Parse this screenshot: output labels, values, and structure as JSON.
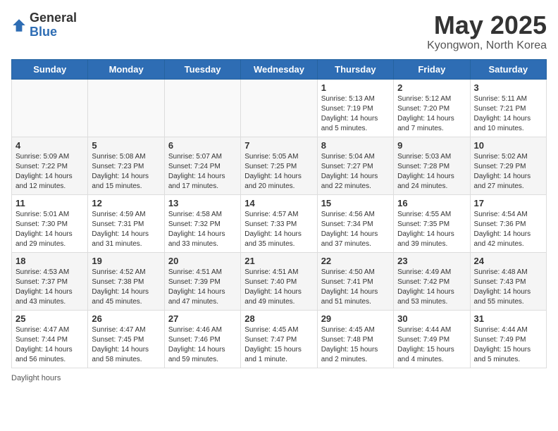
{
  "logo": {
    "general": "General",
    "blue": "Blue"
  },
  "title": "May 2025",
  "subtitle": "Kyongwon, North Korea",
  "days_of_week": [
    "Sunday",
    "Monday",
    "Tuesday",
    "Wednesday",
    "Thursday",
    "Friday",
    "Saturday"
  ],
  "weeks": [
    [
      {
        "day": "",
        "info": ""
      },
      {
        "day": "",
        "info": ""
      },
      {
        "day": "",
        "info": ""
      },
      {
        "day": "",
        "info": ""
      },
      {
        "day": "1",
        "info": "Sunrise: 5:13 AM\nSunset: 7:19 PM\nDaylight: 14 hours and 5 minutes."
      },
      {
        "day": "2",
        "info": "Sunrise: 5:12 AM\nSunset: 7:20 PM\nDaylight: 14 hours and 7 minutes."
      },
      {
        "day": "3",
        "info": "Sunrise: 5:11 AM\nSunset: 7:21 PM\nDaylight: 14 hours and 10 minutes."
      }
    ],
    [
      {
        "day": "4",
        "info": "Sunrise: 5:09 AM\nSunset: 7:22 PM\nDaylight: 14 hours and 12 minutes."
      },
      {
        "day": "5",
        "info": "Sunrise: 5:08 AM\nSunset: 7:23 PM\nDaylight: 14 hours and 15 minutes."
      },
      {
        "day": "6",
        "info": "Sunrise: 5:07 AM\nSunset: 7:24 PM\nDaylight: 14 hours and 17 minutes."
      },
      {
        "day": "7",
        "info": "Sunrise: 5:05 AM\nSunset: 7:25 PM\nDaylight: 14 hours and 20 minutes."
      },
      {
        "day": "8",
        "info": "Sunrise: 5:04 AM\nSunset: 7:27 PM\nDaylight: 14 hours and 22 minutes."
      },
      {
        "day": "9",
        "info": "Sunrise: 5:03 AM\nSunset: 7:28 PM\nDaylight: 14 hours and 24 minutes."
      },
      {
        "day": "10",
        "info": "Sunrise: 5:02 AM\nSunset: 7:29 PM\nDaylight: 14 hours and 27 minutes."
      }
    ],
    [
      {
        "day": "11",
        "info": "Sunrise: 5:01 AM\nSunset: 7:30 PM\nDaylight: 14 hours and 29 minutes."
      },
      {
        "day": "12",
        "info": "Sunrise: 4:59 AM\nSunset: 7:31 PM\nDaylight: 14 hours and 31 minutes."
      },
      {
        "day": "13",
        "info": "Sunrise: 4:58 AM\nSunset: 7:32 PM\nDaylight: 14 hours and 33 minutes."
      },
      {
        "day": "14",
        "info": "Sunrise: 4:57 AM\nSunset: 7:33 PM\nDaylight: 14 hours and 35 minutes."
      },
      {
        "day": "15",
        "info": "Sunrise: 4:56 AM\nSunset: 7:34 PM\nDaylight: 14 hours and 37 minutes."
      },
      {
        "day": "16",
        "info": "Sunrise: 4:55 AM\nSunset: 7:35 PM\nDaylight: 14 hours and 39 minutes."
      },
      {
        "day": "17",
        "info": "Sunrise: 4:54 AM\nSunset: 7:36 PM\nDaylight: 14 hours and 42 minutes."
      }
    ],
    [
      {
        "day": "18",
        "info": "Sunrise: 4:53 AM\nSunset: 7:37 PM\nDaylight: 14 hours and 43 minutes."
      },
      {
        "day": "19",
        "info": "Sunrise: 4:52 AM\nSunset: 7:38 PM\nDaylight: 14 hours and 45 minutes."
      },
      {
        "day": "20",
        "info": "Sunrise: 4:51 AM\nSunset: 7:39 PM\nDaylight: 14 hours and 47 minutes."
      },
      {
        "day": "21",
        "info": "Sunrise: 4:51 AM\nSunset: 7:40 PM\nDaylight: 14 hours and 49 minutes."
      },
      {
        "day": "22",
        "info": "Sunrise: 4:50 AM\nSunset: 7:41 PM\nDaylight: 14 hours and 51 minutes."
      },
      {
        "day": "23",
        "info": "Sunrise: 4:49 AM\nSunset: 7:42 PM\nDaylight: 14 hours and 53 minutes."
      },
      {
        "day": "24",
        "info": "Sunrise: 4:48 AM\nSunset: 7:43 PM\nDaylight: 14 hours and 55 minutes."
      }
    ],
    [
      {
        "day": "25",
        "info": "Sunrise: 4:47 AM\nSunset: 7:44 PM\nDaylight: 14 hours and 56 minutes."
      },
      {
        "day": "26",
        "info": "Sunrise: 4:47 AM\nSunset: 7:45 PM\nDaylight: 14 hours and 58 minutes."
      },
      {
        "day": "27",
        "info": "Sunrise: 4:46 AM\nSunset: 7:46 PM\nDaylight: 14 hours and 59 minutes."
      },
      {
        "day": "28",
        "info": "Sunrise: 4:45 AM\nSunset: 7:47 PM\nDaylight: 15 hours and 1 minute."
      },
      {
        "day": "29",
        "info": "Sunrise: 4:45 AM\nSunset: 7:48 PM\nDaylight: 15 hours and 2 minutes."
      },
      {
        "day": "30",
        "info": "Sunrise: 4:44 AM\nSunset: 7:49 PM\nDaylight: 15 hours and 4 minutes."
      },
      {
        "day": "31",
        "info": "Sunrise: 4:44 AM\nSunset: 7:49 PM\nDaylight: 15 hours and 5 minutes."
      }
    ]
  ],
  "footer": {
    "daylight_label": "Daylight hours"
  }
}
